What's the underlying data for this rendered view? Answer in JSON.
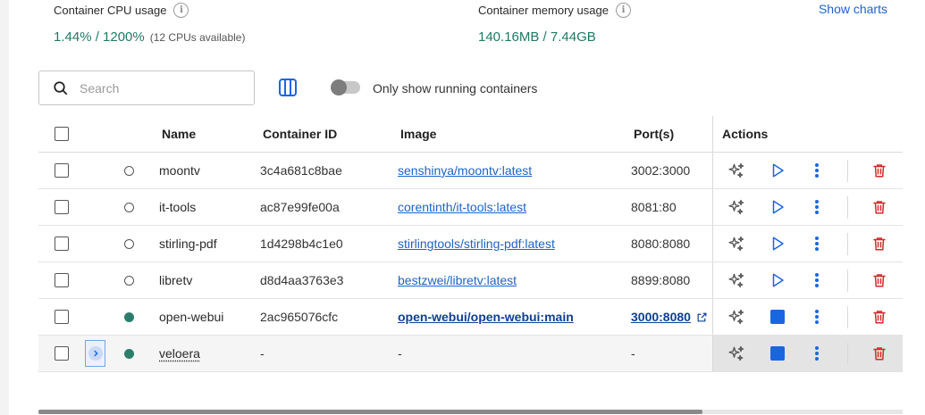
{
  "stats": {
    "cpu_label": "Container CPU usage",
    "cpu_value": "1.44% / 1200%",
    "cpu_sub": "(12 CPUs available)",
    "mem_label": "Container memory usage",
    "mem_value": "140.16MB / 7.44GB",
    "show_charts": "Show charts",
    "info_glyph": "i"
  },
  "toolbar": {
    "search_placeholder": "Search",
    "toggle_label": "Only show running containers",
    "toggle_on": false
  },
  "table": {
    "headers": {
      "name": "Name",
      "id": "Container ID",
      "image": "Image",
      "ports": "Port(s)",
      "actions": "Actions"
    },
    "rows": [
      {
        "name": "moontv",
        "id": "3c4a681c8bae",
        "image": "senshinya/moontv:latest",
        "ports": "3002:3000",
        "status": "stopped"
      },
      {
        "name": "it-tools",
        "id": "ac87e99fe00a",
        "image": "corentinth/it-tools:latest",
        "ports": "8081:80",
        "status": "stopped"
      },
      {
        "name": "stirling-pdf",
        "id": "1d4298b4c1e0",
        "image": "stirlingtools/stirling-pdf:latest",
        "ports": "8080:8080",
        "status": "stopped"
      },
      {
        "name": "libretv",
        "id": "d8d4aa3763e3",
        "image": "bestzwei/libretv:latest",
        "ports": "8899:8080",
        "status": "stopped"
      },
      {
        "name": "open-webui",
        "id": "2ac965076cfc",
        "image": "open-webui/open-webui:main",
        "ports": "3000:8080",
        "status": "running"
      },
      {
        "name": "veloera",
        "id": "-",
        "image": "-",
        "ports": "-",
        "status": "running"
      }
    ]
  },
  "colors": {
    "accent_blue": "#1a66e0",
    "link_blue": "#1d63c9",
    "stat_green": "#1e7a65",
    "running_dot": "#2d7d6c",
    "delete_red": "#d12b2b"
  },
  "icons": [
    "info-icon",
    "search-icon",
    "columns-icon",
    "sparkles-icon",
    "play-icon",
    "stop-icon",
    "kebab-menu-icon",
    "trash-icon",
    "external-link-icon",
    "chevron-right-icon"
  ]
}
